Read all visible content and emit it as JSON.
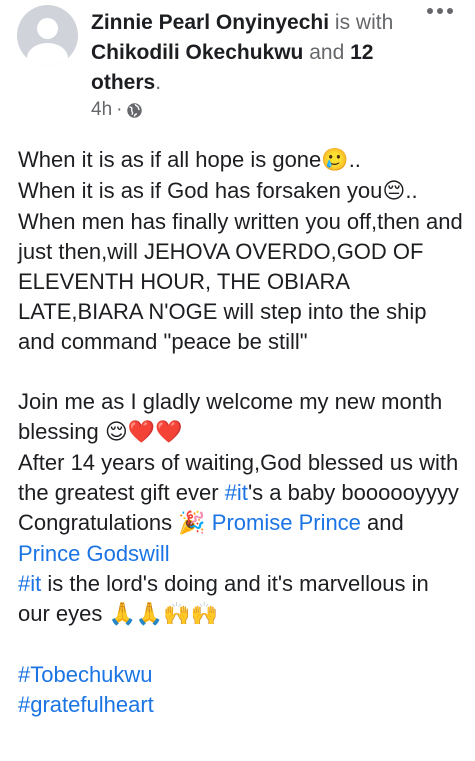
{
  "post": {
    "author": "Zinnie Pearl Onyinyechi",
    "with_text": "is with",
    "tagged": "Chikodili Okechukwu",
    "and_text": "and",
    "others": "12 others",
    "period": ".",
    "time": "4h",
    "sep": "·",
    "privacy_icon": "globe-icon",
    "more_icon": "more-options-icon"
  },
  "body": {
    "p1": {
      "l1": "When it is as if all hope is gone",
      "l1_emoji": "🥲",
      "l1_end": "..",
      "l2": "When it is as if God has forsaken you",
      "l2_emoji": "😔",
      "l2_end": "..",
      "l3": "When men has finally written you off,then and just then,will JEHOVA OVERDO,GOD OF ELEVENTH HOUR, THE OBIARA LATE,BIARA N'OGE will step into the ship and command \"peace be still\""
    },
    "p2": {
      "join": "Join me as I gladly welcome my new month blessing",
      "join_emojis": "😌❤️❤️",
      "after1": "After 14 years of waiting,God blessed us with the greatest gift ever",
      "hashtag_it": "#it",
      "after2": "'s a baby boooooyyyy",
      "congrats": "Congratulations",
      "congrats_emoji": "🎉",
      "name1": "Promise Prince",
      "and": "and",
      "name2": "Prince Godswill",
      "hashtag_it2": "#it",
      "lords": "is the lord's doing and it's marvellous in our eyes",
      "lords_emojis": "🙏🙏🙌🙌"
    },
    "tags": [
      "#Tobechukwu",
      "#gratefulheart"
    ]
  }
}
